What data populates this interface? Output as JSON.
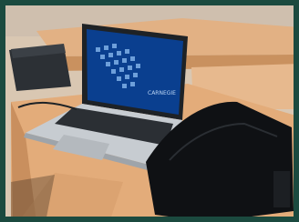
{
  "image": {
    "kind": "photo",
    "subject": "laptop-on-classroom-desk",
    "screen_brand_text": "CARNEGIE"
  },
  "colors": {
    "border": "#1b4a3f",
    "desk": "#e3ac7a",
    "desk_dark": "#c98f5e",
    "floor": "#d9c7b2",
    "laptop_body": "#c7ccd1",
    "keyboard": "#2b2f34",
    "screen": "#0a3f8f",
    "bag": "#0f1114"
  }
}
